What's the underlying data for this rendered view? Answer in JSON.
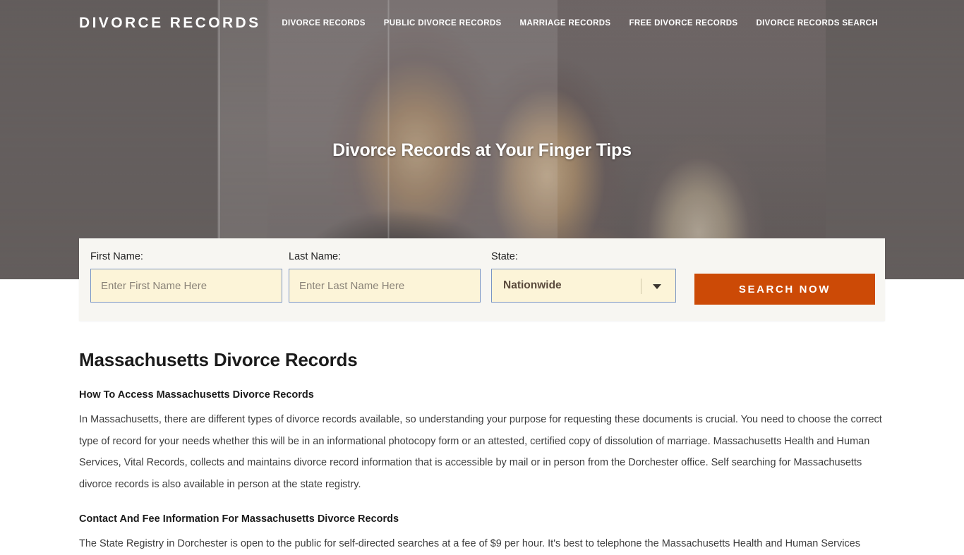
{
  "header": {
    "logo": "DIVORCE RECORDS",
    "nav": [
      {
        "label": "DIVORCE RECORDS"
      },
      {
        "label": "PUBLIC DIVORCE RECORDS"
      },
      {
        "label": "MARRIAGE RECORDS"
      },
      {
        "label": "FREE DIVORCE RECORDS"
      },
      {
        "label": "DIVORCE RECORDS SEARCH"
      }
    ]
  },
  "hero": {
    "title": "Divorce Records at Your Finger Tips",
    "background_color": "#66605F"
  },
  "search_form": {
    "first_name": {
      "label": "First Name:",
      "placeholder": "Enter First Name Here",
      "value": ""
    },
    "last_name": {
      "label": "Last Name:",
      "placeholder": "Enter Last Name Here",
      "value": ""
    },
    "state": {
      "label": "State:",
      "selected": "Nationwide"
    },
    "submit_label": "SEARCH NOW",
    "submit_color": "#CC4A06",
    "panel_color": "#F7F6F2",
    "input_background": "#FCF4D8",
    "input_border": "#7B96C4"
  },
  "main": {
    "title": "Massachusetts Divorce Records",
    "section_1_heading": "How To Access Massachusetts Divorce Records",
    "section_1_body": "In Massachusetts, there are different types of divorce records available, so understanding your purpose for requesting these documents is crucial. You need to choose the correct type of record for your needs whether this will be in an informational photocopy form or an attested, certified copy of dissolution of marriage. Massachusetts Health and Human Services, Vital Records, collects and maintains divorce record information that is accessible by mail or in person from the Dorchester office. Self searching for Massachusetts divorce records is also available in person at the state registry.",
    "section_2_heading": "Contact And Fee Information For Massachusetts Divorce Records",
    "section_2_body": "The State Registry in Dorchester is open to the public for self-directed searches at a fee of $9 per hour. It's best to telephone the Massachusetts Health and Human Services"
  }
}
